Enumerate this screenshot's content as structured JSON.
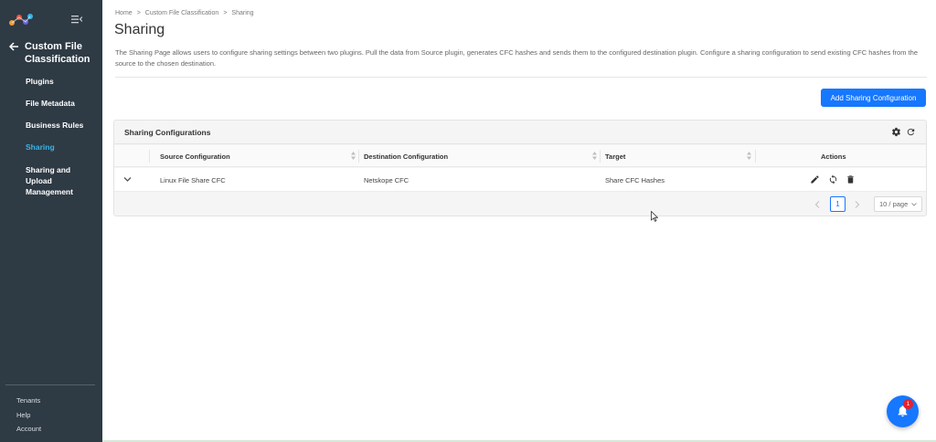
{
  "sidebar": {
    "section_title": "Custom File Classification",
    "items": [
      {
        "label": "Plugins",
        "active": false
      },
      {
        "label": "File Metadata",
        "active": false
      },
      {
        "label": "Business Rules",
        "active": false
      },
      {
        "label": "Sharing",
        "active": true
      },
      {
        "label": "Sharing and Upload Management",
        "active": false
      }
    ],
    "bottom_links": [
      "Tenants",
      "Help",
      "Account"
    ],
    "active_color": "#3ab4e6"
  },
  "breadcrumb": [
    "Home",
    "Custom File Classification",
    "Sharing"
  ],
  "breadcrumb_separator": ">",
  "page": {
    "title": "Sharing",
    "description": "The Sharing Page allows users to configure sharing settings between two plugins. Pull the data from Source plugin, generates CFC hashes and sends them to the configured destination plugin. Configure a sharing configuration to send existing CFC hashes from the source to the chosen destination.",
    "add_button_label": "Add Sharing Configuration"
  },
  "table": {
    "title": "Sharing Configurations",
    "columns": [
      "Source Configuration",
      "Destination Configuration",
      "Target",
      "Actions"
    ],
    "rows": [
      {
        "source": "Linux File Share CFC",
        "destination": "Netskope CFC",
        "target": "Share CFC Hashes"
      }
    ],
    "pagination": {
      "current_page": "1",
      "page_size": "10 / page"
    }
  },
  "notifications": {
    "count": "1"
  },
  "colors": {
    "sidebar_bg": "#2e3a44",
    "primary": "#1677ff",
    "badge": "#e8212a"
  },
  "icons": [
    "logo-icon",
    "collapse-menu-icon",
    "back-arrow-icon",
    "gear-icon",
    "refresh-icon",
    "sort-icon",
    "chevron-down-icon",
    "edit-icon",
    "sync-icon",
    "delete-icon",
    "chevron-left-icon",
    "chevron-right-icon",
    "bell-icon"
  ]
}
